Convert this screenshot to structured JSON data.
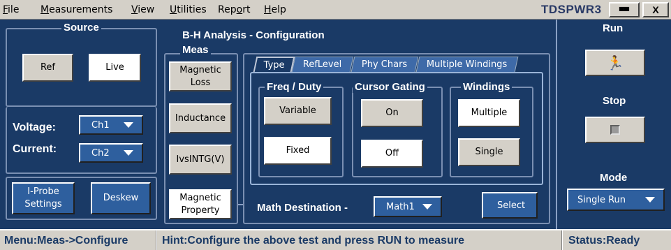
{
  "menubar": {
    "items": [
      {
        "u": "F",
        "rest": "ile"
      },
      {
        "u": "M",
        "rest": "easurements"
      },
      {
        "u": "V",
        "rest": "iew"
      },
      {
        "u": "U",
        "rest": "tilities"
      },
      {
        "u": "Rep",
        "u_pos": "o",
        "rest": "rt"
      },
      {
        "u": "H",
        "rest": "elp"
      }
    ],
    "app_title": "TDSPWR3",
    "restore_glyph": "▀▀",
    "close_glyph": "X"
  },
  "source": {
    "title": "Source",
    "ref_label": "Ref",
    "live_label": "Live",
    "voltage_label": "Voltage:",
    "voltage_value": "Ch1",
    "current_label": "Current:",
    "current_value": "Ch2",
    "iprobe_label": "I-Probe Settings",
    "deskew_label": "Deskew"
  },
  "header": {
    "title": "B-H Analysis - Configuration"
  },
  "meas": {
    "title": "Meas",
    "items": [
      "Magnetic Loss",
      "Inductance",
      "IvsINTG(V)",
      "Magnetic Property"
    ]
  },
  "tabs": [
    "Type",
    "RefLevel",
    "Phy Chars",
    "Multiple Windings"
  ],
  "config": {
    "freq_duty": {
      "title": "Freq / Duty",
      "variable": "Variable",
      "fixed": "Fixed"
    },
    "cursor_gating": {
      "title": "Cursor Gating",
      "on": "On",
      "off": "Off"
    },
    "windings": {
      "title": "Windings",
      "multiple": "Multiple",
      "single": "Single"
    },
    "math_destination_label": "Math Destination -",
    "math_destination_value": "Math1",
    "select_label": "Select"
  },
  "controls": {
    "run_title": "Run",
    "run_icon": "🏃",
    "stop_title": "Stop",
    "mode_title": "Mode",
    "mode_value": "Single Run"
  },
  "statusbar": {
    "menu": "Menu:Meas->Configure",
    "hint": "Hint:Configure the above test and press RUN to measure",
    "status": "Status:Ready"
  }
}
